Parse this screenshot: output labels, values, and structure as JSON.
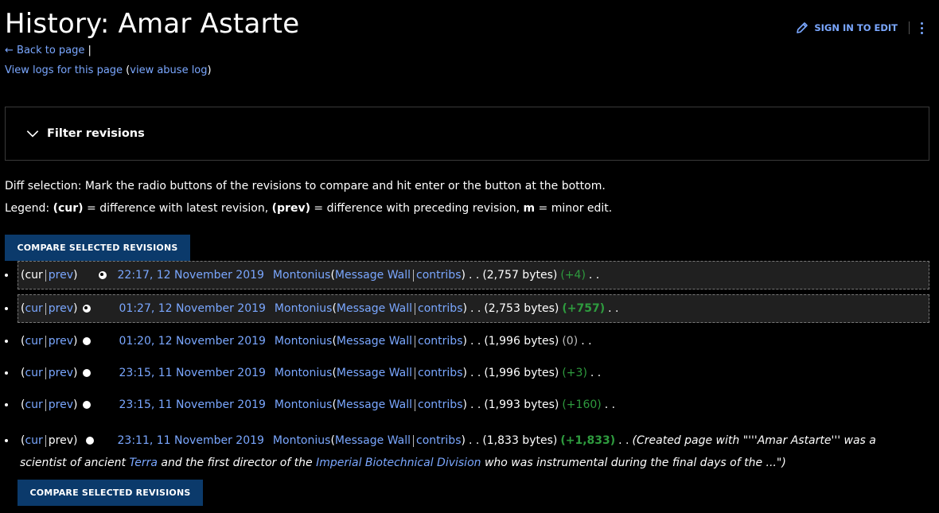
{
  "header": {
    "title": "History: Amar Astarte",
    "back_to_page": "Back to page",
    "view_logs": "View logs for this page",
    "view_abuse_log": "view abuse log",
    "sign_in_to_edit": "SIGN IN TO EDIT"
  },
  "filter": {
    "label": "Filter revisions"
  },
  "diff_info": {
    "line1": "Diff selection: Mark the radio buttons of the revisions to compare and hit enter or the button at the bottom.",
    "legend_prefix": "Legend: ",
    "cur": "(cur)",
    "cur_desc": " = difference with latest revision, ",
    "prev": "(prev)",
    "prev_desc": " = difference with preceding revision, ",
    "m": "m",
    "m_desc": " = minor edit."
  },
  "compare_button": "COMPARE SELECTED REVISIONS",
  "labels": {
    "cur": "cur",
    "prev": "prev",
    "message_wall": "Message Wall",
    "contribs": "contribs"
  },
  "revisions": [
    {
      "date": "22:17, 12 November 2019",
      "user": "Montonius",
      "size": "(2,757 bytes)",
      "delta": "(+4)",
      "delta_style": "green",
      "checked": true,
      "cur_link": false,
      "prev_link": true
    },
    {
      "date": "01:27, 12 November 2019",
      "user": "Montonius",
      "size": "(2,753 bytes)",
      "delta": "(+757)",
      "delta_style": "green-bold",
      "checked": true,
      "cur_link": true,
      "prev_link": true
    },
    {
      "date": "01:20, 12 November 2019",
      "user": "Montonius",
      "size": "(1,996 bytes)",
      "delta": "(0)",
      "delta_style": "grey",
      "checked": false,
      "cur_link": true,
      "prev_link": true
    },
    {
      "date": "23:15, 11 November 2019",
      "user": "Montonius",
      "size": "(1,996 bytes)",
      "delta": "(+3)",
      "delta_style": "green",
      "checked": false,
      "cur_link": true,
      "prev_link": true
    },
    {
      "date": "23:15, 11 November 2019",
      "user": "Montonius",
      "size": "(1,993 bytes)",
      "delta": "(+160)",
      "delta_style": "green",
      "checked": false,
      "cur_link": true,
      "prev_link": true
    }
  ],
  "last_revision": {
    "date": "23:11, 11 November 2019",
    "user": "Montonius",
    "size": "(1,833 bytes)",
    "delta": "(+1,833)",
    "comment_prefix": "(Created page with \"'''Amar Astarte''' was a",
    "comment_line2_a": "scientist of ancient ",
    "link_terra": "Terra",
    "comment_line2_b": " and the first director of the ",
    "link_ibd": "Imperial Biotechnical Division",
    "comment_line2_c": " who was instrumental during the final days of the ...\")"
  }
}
